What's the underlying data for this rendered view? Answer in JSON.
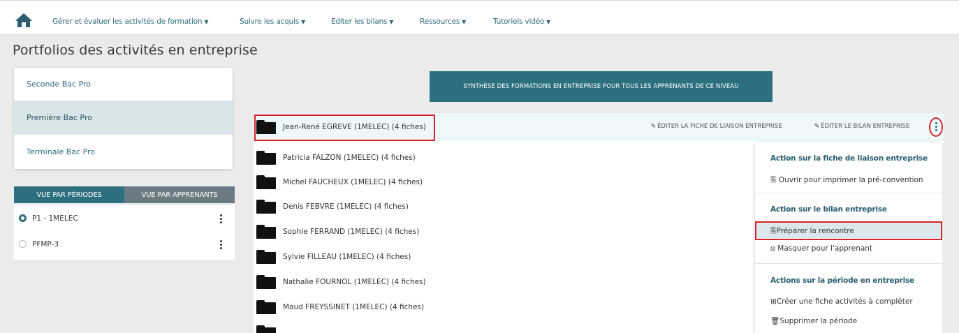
{
  "nav": {
    "menus": [
      {
        "label": "Gérer et évaluer les activités de formation"
      },
      {
        "label": "Suivre les acquis"
      },
      {
        "label": "Editer les bilans"
      },
      {
        "label": "Ressources"
      },
      {
        "label": "Tutoriels vidéo"
      }
    ]
  },
  "page_title": "Portfolios des activités en entreprise",
  "levels": [
    {
      "label": "Seconde Bac Pro"
    },
    {
      "label": "Première Bac Pro"
    },
    {
      "label": "Terminale Bac Pro"
    }
  ],
  "view_toggle": {
    "by_period": "VUE PAR PÉRIODES",
    "by_learner": "VUE PAR APPRENANTS"
  },
  "periods": [
    {
      "label": "P1 - 1MELEC"
    },
    {
      "label": "PFMP-3"
    }
  ],
  "synthesis_button": "SYNTHÈSE DES FORMATIONS EN ENTREPRISE POUR TOUS LES APPRENANTS DE CE NIVEAU",
  "students": [
    {
      "label": "Jean-René EGREVE (1MELEC) (4 fiches)"
    },
    {
      "label": "Patricia FALZON (1MELEC) (4 fiches)"
    },
    {
      "label": "Michel FAUCHEUX (1MELEC) (4 fiches)"
    },
    {
      "label": "Denis FEBVRE (1MELEC) (4 fiches)"
    },
    {
      "label": "Sophie FERRAND (1MELEC) (4 fiches)"
    },
    {
      "label": "Sylvie FILLEAU (1MELEC) (4 fiches)"
    },
    {
      "label": "Nathalie FOURNOL (1MELEC) (4 fiches)"
    },
    {
      "label": "Maud FREYSSINET (1MELEC) (4 fiches)"
    }
  ],
  "row_actions": {
    "edit_liaison": "ÉDITER LA FICHE DE LIAISON ENTREPRISE",
    "edit_bilan": "ÉDITER LE BILAN ENTREPRISE"
  },
  "action_panel": {
    "section1_title": "Action sur la fiche de liaison entreprise",
    "open_print": "Ouvrir pour imprimer la pré-convention",
    "section2_title": "Action sur le bilan entreprise",
    "prepare_meeting": "Préparer la rencontre",
    "hide_learner": "Masquer pour l'apprenant",
    "section3_title": "Actions sur la période en entreprise",
    "create_sheet": "Créer une fiche activités à compléter",
    "delete_period": "Supprimer la période"
  },
  "colors": {
    "accent": "#2c6f7f",
    "highlight": "#d9222e"
  }
}
